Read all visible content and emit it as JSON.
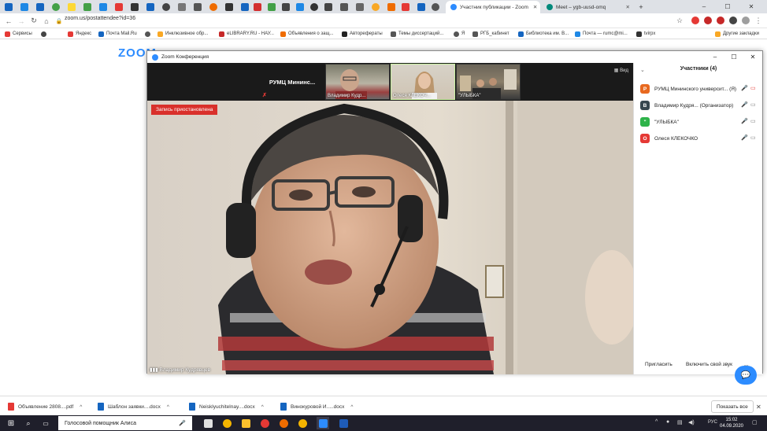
{
  "browser": {
    "tabs": [
      {
        "title": "Участник публикации - Zoom",
        "active": true,
        "icon_color": "#2d8cff"
      },
      {
        "title": "Meet – ygb-uusd-omq",
        "active": false,
        "icon_color": "#00897b"
      }
    ],
    "new_tab": "+",
    "window_controls": {
      "minimize": "–",
      "maximize": "☐",
      "close": "✕"
    },
    "url": "zoom.us/postattendee?id=36",
    "bookmarks": [
      {
        "label": "Сервисы",
        "color": "#e53935"
      },
      {
        "label": "",
        "color": "#444444"
      },
      {
        "label": "Яндекс",
        "color": "#e53935"
      },
      {
        "label": "Почта Mail.Ru",
        "color": "#1565c0"
      },
      {
        "label": "",
        "color": "#555555"
      },
      {
        "label": "Инклюзивное обр...",
        "color": "#f9a825"
      },
      {
        "label": "eLIBRARY.RU - НАУ...",
        "color": "#c62828"
      },
      {
        "label": "Объявления о защ...",
        "color": "#ef6c00"
      },
      {
        "label": "Авторефераты",
        "color": "#222222"
      },
      {
        "label": "Темы диссертаций...",
        "color": "#555555"
      },
      {
        "label": "Я",
        "color": "#e53935"
      },
      {
        "label": "РГБ_кабинет",
        "color": "#555555"
      },
      {
        "label": "Библиотека им. В...",
        "color": "#1565c0"
      },
      {
        "label": "Почта — rumc@mi...",
        "color": "#1e88e5"
      },
      {
        "label": "tvirpx",
        "color": "#333333"
      },
      {
        "label": "Другие закладки",
        "color": "#f9a825"
      }
    ]
  },
  "zoom_logo": "ZOOM",
  "zoom_window": {
    "title": "Zoom Конференция",
    "view_button": "Вид",
    "recording_status": "Запись приостановлена",
    "active_speaker": "Владимир Кудрявцев",
    "strip": [
      {
        "name": "РУМЦ Мининс...",
        "kind": "text"
      },
      {
        "name": "Владимир Кудр...",
        "kind": "video"
      },
      {
        "name": "Олеся КЛЕКОЧ...",
        "kind": "video"
      },
      {
        "name": "\"УЛЫБКА\"",
        "kind": "video"
      }
    ],
    "participants_panel": {
      "title": "Участники (4)",
      "participants": [
        {
          "initial": "Р",
          "name": "РУМЦ Мининского университ... (Я)",
          "color": "#e8691f",
          "mic": "muted-red",
          "cam": "off-red"
        },
        {
          "initial": "В",
          "name": "Владимир Кудря... (Организатор)",
          "color": "#37474f",
          "mic": "on",
          "cam": "on"
        },
        {
          "initial": "\"",
          "name": "\"УЛЫБКА\"",
          "color": "#2eb34a",
          "mic": "on",
          "cam": "on"
        },
        {
          "initial": "О",
          "name": "Олеся КЛЕКОЧКО",
          "color": "#e53935",
          "mic": "on",
          "cam": "on"
        }
      ],
      "invite": "Пригласить",
      "unmute": "Включить свой звук",
      "more": "..."
    }
  },
  "downloads": {
    "items": [
      {
        "name": "Объявление 2808....pdf",
        "color": "#e53935"
      },
      {
        "name": "Шаблон заявки....docx",
        "color": "#1565c0"
      },
      {
        "name": "Neisklyuchitelnay....docx",
        "color": "#1565c0"
      },
      {
        "name": "Винокуровой И.....docx",
        "color": "#1565c0"
      }
    ],
    "show_all": "Показать все"
  },
  "taskbar": {
    "search_text": "Голосовой помощник Алиса",
    "language": "РУС",
    "time": "15:02",
    "date": "04.09.2020"
  }
}
